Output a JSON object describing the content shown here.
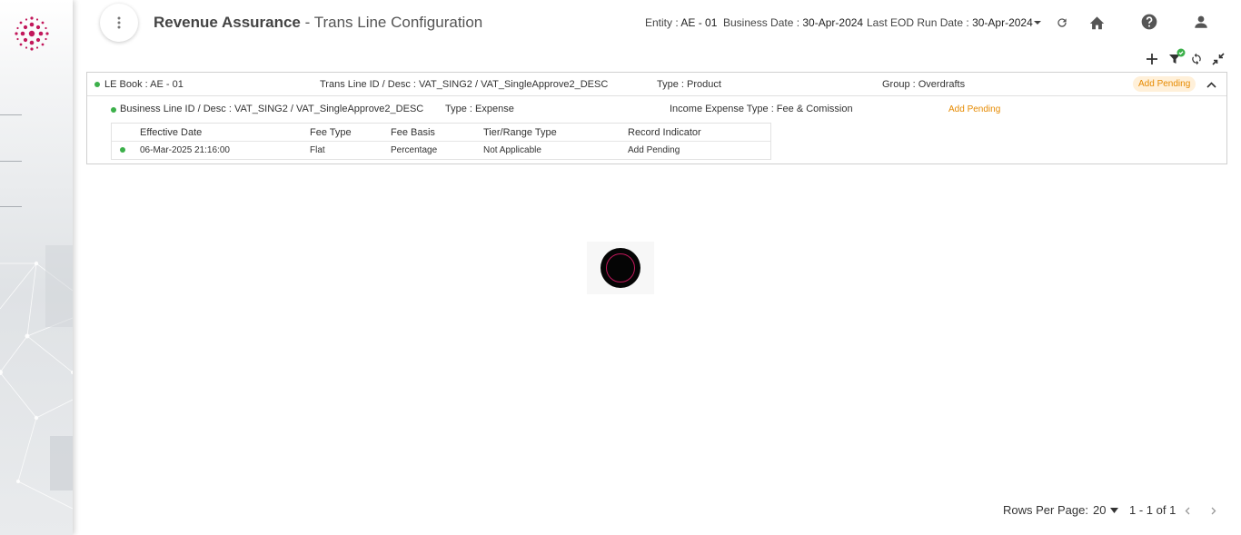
{
  "header": {
    "module": "Revenue Assurance",
    "separator": " - ",
    "page": "Trans Line Configuration",
    "entity_label": "Entity : ",
    "entity_value": "AE - 01",
    "business_date_label": "Business Date : ",
    "business_date_value": "30-Apr-2024",
    "eod_label": "Last EOD Run Date : ",
    "eod_value": "30-Apr-2024"
  },
  "record": {
    "le_book": "LE Book : AE - 01",
    "trans_line": "Trans Line ID / Desc : VAT_SING2 / VAT_SingleApprove2_DESC",
    "type": "Type : Product",
    "group": "Group : Overdrafts",
    "status": "Add Pending",
    "business_line": "Business Line ID / Desc : VAT_SING2 / VAT_SingleApprove2_DESC",
    "bl_type": "Type : Expense",
    "income_expense_type": "Income Expense Type : Fee & Comission",
    "bl_status": "Add Pending"
  },
  "fee_table": {
    "columns": [
      "Effective Date",
      "Fee Type",
      "Fee Basis",
      "Tier/Range Type",
      "Record Indicator"
    ],
    "rows": [
      [
        "06-Mar-2025 21:16:00",
        "Flat",
        "Percentage",
        "Not Applicable",
        "Add Pending"
      ]
    ]
  },
  "pagination": {
    "rows_per_page_label": "Rows Per Page:",
    "rows_per_page_value": "20",
    "range": "1 - 1 of 1"
  },
  "colors": {
    "status_active": "#3cb04a",
    "pending": "#e68a00",
    "brand": "#c2185b"
  }
}
